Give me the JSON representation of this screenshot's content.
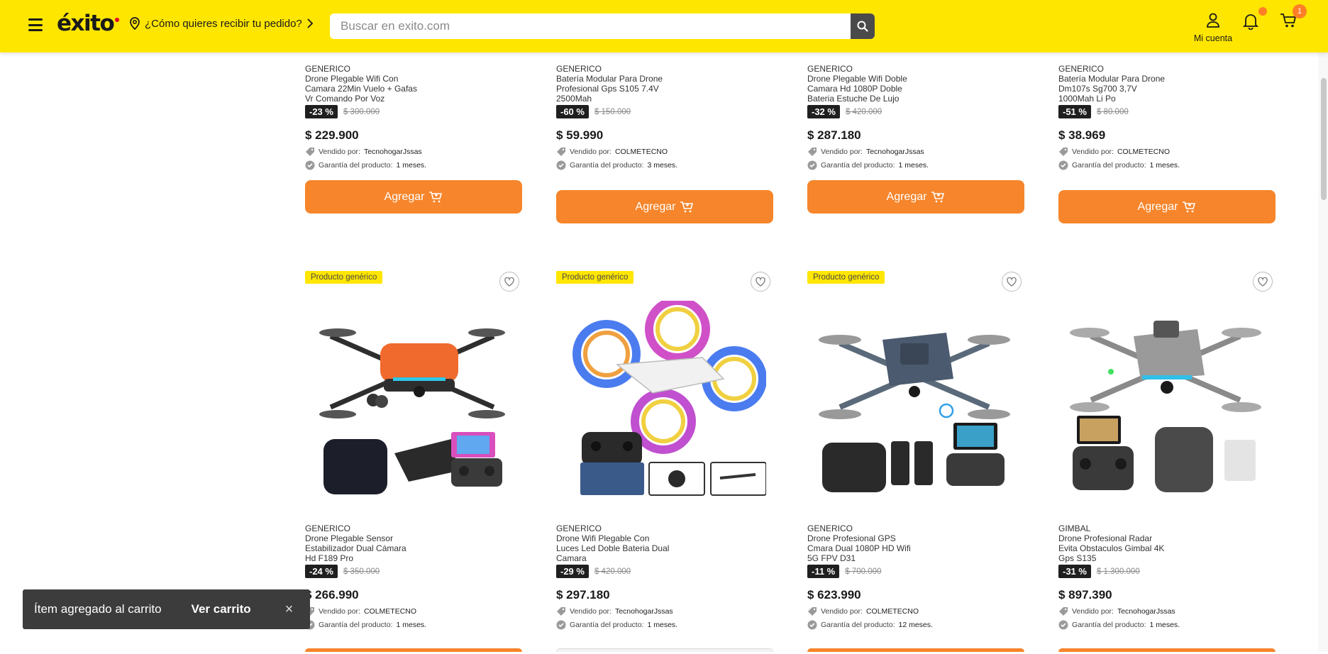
{
  "header": {
    "logo": "éxito",
    "delivery_label": "¿Cómo quieres recibir tu pedido?",
    "search_placeholder": "Buscar en exito.com",
    "account_label": "Mi cuenta",
    "cart_count": "1",
    "brand_color": "#ffe600",
    "accent_color": "#f6852b"
  },
  "add_label": "Agregar",
  "sold_by_label": "Vendido por:",
  "warranty_label": "Garantía del producto:",
  "generic_badge": "Producto genérico",
  "row1": [
    {
      "brand": "GENERICO",
      "name": "Drone Plegable Wifi Con Camara 22Min Vuelo + Gafas Vr Comando Por Voz",
      "discount": "-23 %",
      "old_price": "$ 300.000",
      "price": "$ 229.900",
      "seller": "TecnohogarJssas",
      "warranty": "1 meses."
    },
    {
      "brand": "GENERICO",
      "name": "Batería Modular Para Drone Profesional Gps S105 7.4V 2500Mah",
      "discount": "-60 %",
      "old_price": "$ 150.000",
      "price": "$ 59.990",
      "seller": "COLMETECNO",
      "warranty": "3 meses."
    },
    {
      "brand": "GENERICO",
      "name": "Drone Plegable Wifi Doble Camara Hd 1080P Doble Bateria Estuche De Lujo",
      "discount": "-32 %",
      "old_price": "$ 420.000",
      "price": "$ 287.180",
      "seller": "TecnohogarJssas",
      "warranty": "1 meses."
    },
    {
      "brand": "GENERICO",
      "name": "Batería Modular Para Drone Dm107s Sg700 3,7V 1000Mah Li Po",
      "discount": "-51 %",
      "old_price": "$ 80.000",
      "price": "$ 38.969",
      "seller": "COLMETECNO",
      "warranty": "1 meses."
    }
  ],
  "row2": [
    {
      "brand": "GENERICO",
      "name": "Drone Plegable Sensor Estabilizador Dual Cámara Hd F189 Pro",
      "discount": "-24 %",
      "old_price": "$ 350.000",
      "price": "$ 266.990",
      "seller": "COLMETECNO",
      "warranty": "1 meses.",
      "generic": true
    },
    {
      "brand": "GENERICO",
      "name": "Drone Wifi Plegable Con Luces Led Doble Bateria Dual Camara",
      "discount": "-29 %",
      "old_price": "$ 420.000",
      "price": "$ 297.180",
      "seller": "TecnohogarJssas",
      "warranty": "1 meses.",
      "generic": true
    },
    {
      "brand": "GENERICO",
      "name": "Drone Profesional GPS Cmara Dual 1080P HD Wifi 5G FPV D31",
      "discount": "-11 %",
      "old_price": "$ 700.000",
      "price": "$ 623.990",
      "seller": "COLMETECNO",
      "warranty": "12 meses.",
      "generic": true
    },
    {
      "brand": "GIMBAL",
      "name": "Drone Profesional Radar Evita Obstaculos Gimbal 4K Gps S135",
      "discount": "-31 %",
      "old_price": "$ 1.300.000",
      "price": "$ 897.390",
      "seller": "TecnohogarJssas",
      "warranty": "1 meses.",
      "generic": false
    }
  ],
  "toast": {
    "message": "Ítem agregado al carrito",
    "action": "Ver carrito",
    "close": "×"
  }
}
